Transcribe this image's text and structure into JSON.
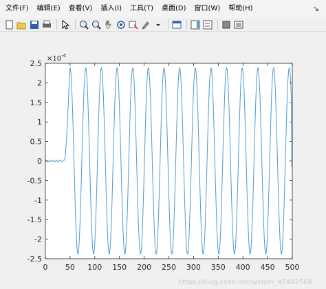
{
  "menu": {
    "items": [
      "文件(F)",
      "编辑(E)",
      "查看(V)",
      "插入(I)",
      "工具(T)",
      "桌面(D)",
      "窗口(W)",
      "帮助(H)"
    ],
    "arrow": "↘"
  },
  "toolbar": {
    "icons": [
      "new-figure-icon",
      "open-file-icon",
      "save-icon",
      "print-icon",
      "pointer-icon",
      "zoom-in-icon",
      "zoom-out-icon",
      "pan-icon",
      "rotate-3d-icon",
      "data-cursor-icon",
      "brush-icon",
      "dropdown-icon",
      "link-plot-icon",
      "colorbar-icon",
      "legend-icon",
      "hide-plot-tools-icon",
      "show-plot-tools-icon"
    ]
  },
  "chart_data": {
    "type": "line",
    "title": "",
    "xlabel": "",
    "ylabel": "",
    "xlim": [
      0,
      500
    ],
    "ylim": [
      -2.5,
      2.5
    ],
    "x_ticks": [
      "0",
      "50",
      "100",
      "150",
      "200",
      "250",
      "300",
      "350",
      "400",
      "450",
      "500"
    ],
    "y_ticks": [
      "2.5",
      "2",
      "1.5",
      "1",
      "0.5",
      "0",
      "-0.5",
      "-1",
      "-1.5",
      "-2",
      "-2.5"
    ],
    "y_exponent_label": "×10",
    "y_exponent_power": "-4",
    "grid": false,
    "series": [
      {
        "color": "#4a9bd4",
        "flat_until": 38,
        "ramp_end": 50,
        "amplitude": 2.38,
        "period": 31.7,
        "x": [
          0,
          38,
          50,
          500
        ],
        "y": [
          0.0,
          0.0,
          2.38,
          -0.15
        ]
      }
    ]
  },
  "watermark": "https://blog.csdn.net/weixin_45442568",
  "colors": {
    "line": "#4a9bd4",
    "axis": "#262626"
  }
}
